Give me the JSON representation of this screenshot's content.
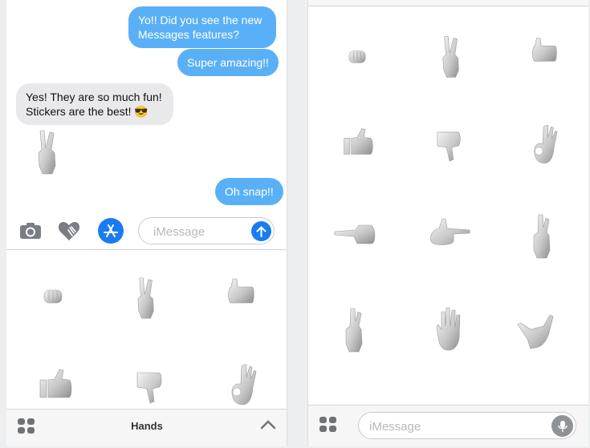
{
  "left_screen": {
    "messages": [
      {
        "type": "sent",
        "text": "Yo!! Did you see the new Messages features?"
      },
      {
        "type": "sent",
        "text": "Super amazing!!"
      },
      {
        "type": "received",
        "text": "Yes! They are so much fun! Stickers are the best! 😎"
      },
      {
        "type": "sticker",
        "name": "peace-hand"
      },
      {
        "type": "sent",
        "text": "Oh snap!!"
      }
    ],
    "compose": {
      "placeholder": "iMessage"
    },
    "drawer": {
      "title": "Hands"
    },
    "stickers": [
      "fist",
      "peace",
      "thumbs-up-sideways",
      "thumbs-up",
      "thumbs-down",
      "ok"
    ]
  },
  "right_screen": {
    "stickers": [
      "fist",
      "peace",
      "thumbs-up-sideways",
      "thumbs-up",
      "thumbs-down",
      "ok",
      "point-left",
      "finger-gun",
      "crossed-fingers",
      "crossed-fingers-2",
      "open-palm",
      "shaka"
    ],
    "compose": {
      "placeholder": "iMessage"
    }
  },
  "colors": {
    "sent_bubble": "#5ab0f7",
    "received_bubble": "#e9e9ec",
    "accent": "#1a7cf0"
  }
}
